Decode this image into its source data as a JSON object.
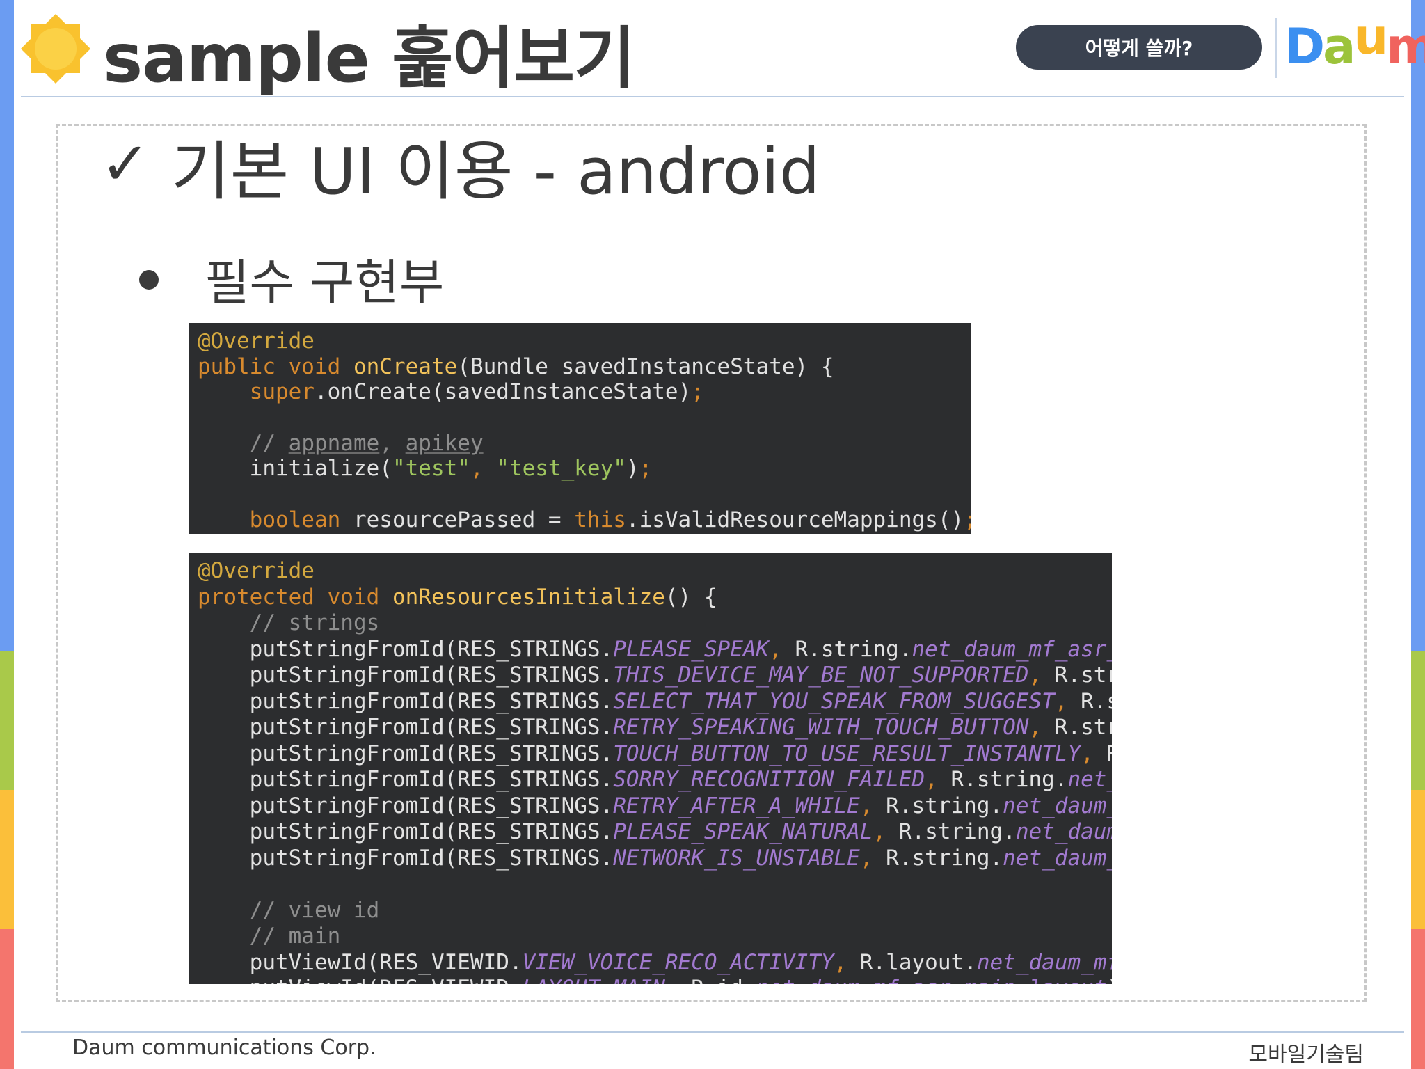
{
  "header": {
    "title": "sample 훑어보기",
    "howto_button": "어떻게 쓸까?",
    "logo": {
      "letters": [
        "D",
        "a",
        "u",
        "m"
      ],
      "colors": [
        "#3b8ff0",
        "#9cc33b",
        "#f9b72a",
        "#f0635e"
      ]
    }
  },
  "section": {
    "check_mark": "✓",
    "title": "기본 UI 이용 - android",
    "bullet": "필수 구현부"
  },
  "code_block_1": [
    [
      {
        "t": "@Override",
        "c": "kw-ann"
      }
    ],
    [
      {
        "t": "public void ",
        "c": "kw"
      },
      {
        "t": "onCreate",
        "c": "fn"
      },
      {
        "t": "(Bundle savedInstanceState) {",
        "c": "plain"
      }
    ],
    [
      {
        "t": "    ",
        "c": "plain"
      },
      {
        "t": "super",
        "c": "kw"
      },
      {
        "t": ".onCreate(savedInstanceState)",
        "c": "plain"
      },
      {
        "t": ";",
        "c": "kw"
      }
    ],
    [
      {
        "t": "",
        "c": "plain"
      }
    ],
    [
      {
        "t": "    // ",
        "c": "cmt"
      },
      {
        "t": "appname",
        "c": "cmt und"
      },
      {
        "t": ", ",
        "c": "cmt"
      },
      {
        "t": "apikey",
        "c": "cmt und"
      }
    ],
    [
      {
        "t": "    initialize(",
        "c": "plain"
      },
      {
        "t": "\"test\"",
        "c": "str"
      },
      {
        "t": ", ",
        "c": "kw"
      },
      {
        "t": "\"test_key\"",
        "c": "str"
      },
      {
        "t": ")",
        "c": "plain"
      },
      {
        "t": ";",
        "c": "kw"
      }
    ],
    [
      {
        "t": "",
        "c": "plain"
      }
    ],
    [
      {
        "t": "    ",
        "c": "plain"
      },
      {
        "t": "boolean ",
        "c": "kw"
      },
      {
        "t": "resourcePassed = ",
        "c": "plain"
      },
      {
        "t": "this",
        "c": "kw"
      },
      {
        "t": ".isValidResourceMappings()",
        "c": "plain"
      },
      {
        "t": ";",
        "c": "kw"
      }
    ]
  ],
  "code_block_2": [
    [
      {
        "t": "@Override",
        "c": "kw-ann"
      }
    ],
    [
      {
        "t": "protected void ",
        "c": "kw"
      },
      {
        "t": "onResourcesInitialize",
        "c": "fn"
      },
      {
        "t": "() {",
        "c": "plain"
      }
    ],
    [
      {
        "t": "    // strings",
        "c": "cmt"
      }
    ],
    [
      {
        "t": "    putStringFromId(RES_STRINGS.",
        "c": "plain"
      },
      {
        "t": "PLEASE_SPEAK",
        "c": "cons"
      },
      {
        "t": ", ",
        "c": "kw"
      },
      {
        "t": "R.string.",
        "c": "plain"
      },
      {
        "t": "net_daum_mf_asr_vo",
        "c": "lay"
      }
    ],
    [
      {
        "t": "    putStringFromId(RES_STRINGS.",
        "c": "plain"
      },
      {
        "t": "THIS_DEVICE_MAY_BE_NOT_SUPPORTED",
        "c": "cons"
      },
      {
        "t": ", ",
        "c": "kw"
      },
      {
        "t": "R.strin",
        "c": "plain"
      }
    ],
    [
      {
        "t": "    putStringFromId(RES_STRINGS.",
        "c": "plain"
      },
      {
        "t": "SELECT_THAT_YOU_SPEAK_FROM_SUGGEST",
        "c": "cons"
      },
      {
        "t": ", ",
        "c": "kw"
      },
      {
        "t": "R.str",
        "c": "plain"
      }
    ],
    [
      {
        "t": "    putStringFromId(RES_STRINGS.",
        "c": "plain"
      },
      {
        "t": "RETRY_SPEAKING_WITH_TOUCH_BUTTON",
        "c": "cons"
      },
      {
        "t": ", ",
        "c": "kw"
      },
      {
        "t": "R.strin",
        "c": "plain"
      }
    ],
    [
      {
        "t": "    putStringFromId(RES_STRINGS.",
        "c": "plain"
      },
      {
        "t": "TOUCH_BUTTON_TO_USE_RESULT_INSTANTLY",
        "c": "cons"
      },
      {
        "t": ", ",
        "c": "kw"
      },
      {
        "t": "R.s",
        "c": "plain"
      }
    ],
    [
      {
        "t": "    putStringFromId(RES_STRINGS.",
        "c": "plain"
      },
      {
        "t": "SORRY_RECOGNITION_FAILED",
        "c": "cons"
      },
      {
        "t": ", ",
        "c": "kw"
      },
      {
        "t": "R.string.",
        "c": "plain"
      },
      {
        "t": "net_da",
        "c": "lay"
      }
    ],
    [
      {
        "t": "    putStringFromId(RES_STRINGS.",
        "c": "plain"
      },
      {
        "t": "RETRY_AFTER_A_WHILE",
        "c": "cons"
      },
      {
        "t": ", ",
        "c": "kw"
      },
      {
        "t": "R.string.",
        "c": "plain"
      },
      {
        "t": "net_daum_mf",
        "c": "lay"
      }
    ],
    [
      {
        "t": "    putStringFromId(RES_STRINGS.",
        "c": "plain"
      },
      {
        "t": "PLEASE_SPEAK_NATURAL",
        "c": "cons"
      },
      {
        "t": ", ",
        "c": "kw"
      },
      {
        "t": "R.string.",
        "c": "plain"
      },
      {
        "t": "net_daum_m",
        "c": "lay"
      }
    ],
    [
      {
        "t": "    putStringFromId(RES_STRINGS.",
        "c": "plain"
      },
      {
        "t": "NETWORK_IS_UNSTABLE",
        "c": "cons"
      },
      {
        "t": ", ",
        "c": "kw"
      },
      {
        "t": "R.string.",
        "c": "plain"
      },
      {
        "t": "net_daum_mf",
        "c": "lay"
      }
    ],
    [
      {
        "t": "",
        "c": "plain"
      }
    ],
    [
      {
        "t": "    // view id",
        "c": "cmt"
      }
    ],
    [
      {
        "t": "    // main",
        "c": "cmt"
      }
    ],
    [
      {
        "t": "    putViewId(RES_VIEWID.",
        "c": "plain"
      },
      {
        "t": "VIEW_VOICE_RECO_ACTIVITY",
        "c": "cons"
      },
      {
        "t": ", ",
        "c": "kw"
      },
      {
        "t": "R.layout.",
        "c": "plain"
      },
      {
        "t": "net_daum_mf_a",
        "c": "lay"
      }
    ],
    [
      {
        "t": "    putViewId(RES_VIEWID.",
        "c": "plain"
      },
      {
        "t": "LAYOUT_MAIN",
        "c": "cons"
      },
      {
        "t": ", ",
        "c": "kw"
      },
      {
        "t": "R.id.",
        "c": "plain"
      },
      {
        "t": "net_daum_mf_asr_main_layout",
        "c": "lay"
      },
      {
        "t": ");",
        "c": "plain"
      }
    ]
  ],
  "footer": {
    "company": "Daum communications Corp.",
    "team": "모바일기술팀"
  },
  "theme": {
    "edge_stripes": [
      "#6b9cf2",
      "#a9c94a",
      "#fbbf3a",
      "#f4756d"
    ],
    "code_background": "#2c2d2f",
    "sun_color": "#f9c22e"
  }
}
